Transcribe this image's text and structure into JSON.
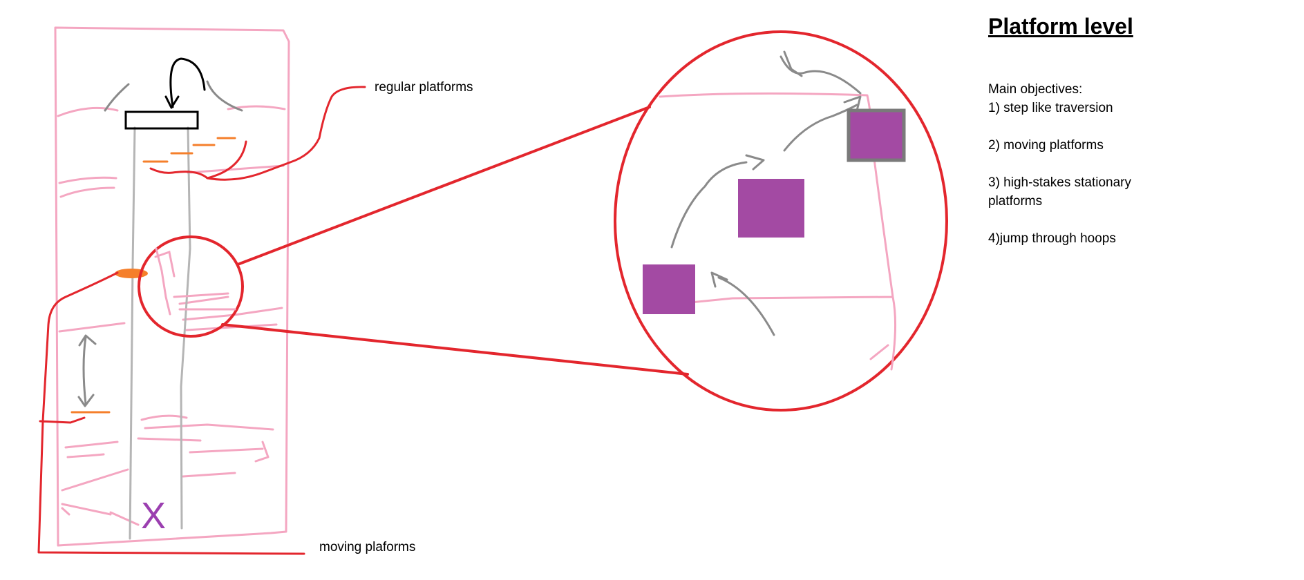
{
  "title": "Platform level",
  "objectives": {
    "heading": "Main objectives:",
    "items": [
      "1) step like traversion",
      "2) moving platforms",
      "3) high-stakes stationary platforms",
      "4)jump through hoops"
    ]
  },
  "labels": {
    "regular_platforms": "regular platforms",
    "moving_platforms": "moving plaforms",
    "goal_mark": "X"
  },
  "colors": {
    "level_outline": "#f4a6c1",
    "callout": "#e3262d",
    "platform_orange": "#f57f2b",
    "guide_gray": "#b5b5b5",
    "arrow_gray": "#8a8a8a",
    "block_purple": "#a34aa3",
    "goal_purple": "#9b3fb0"
  }
}
